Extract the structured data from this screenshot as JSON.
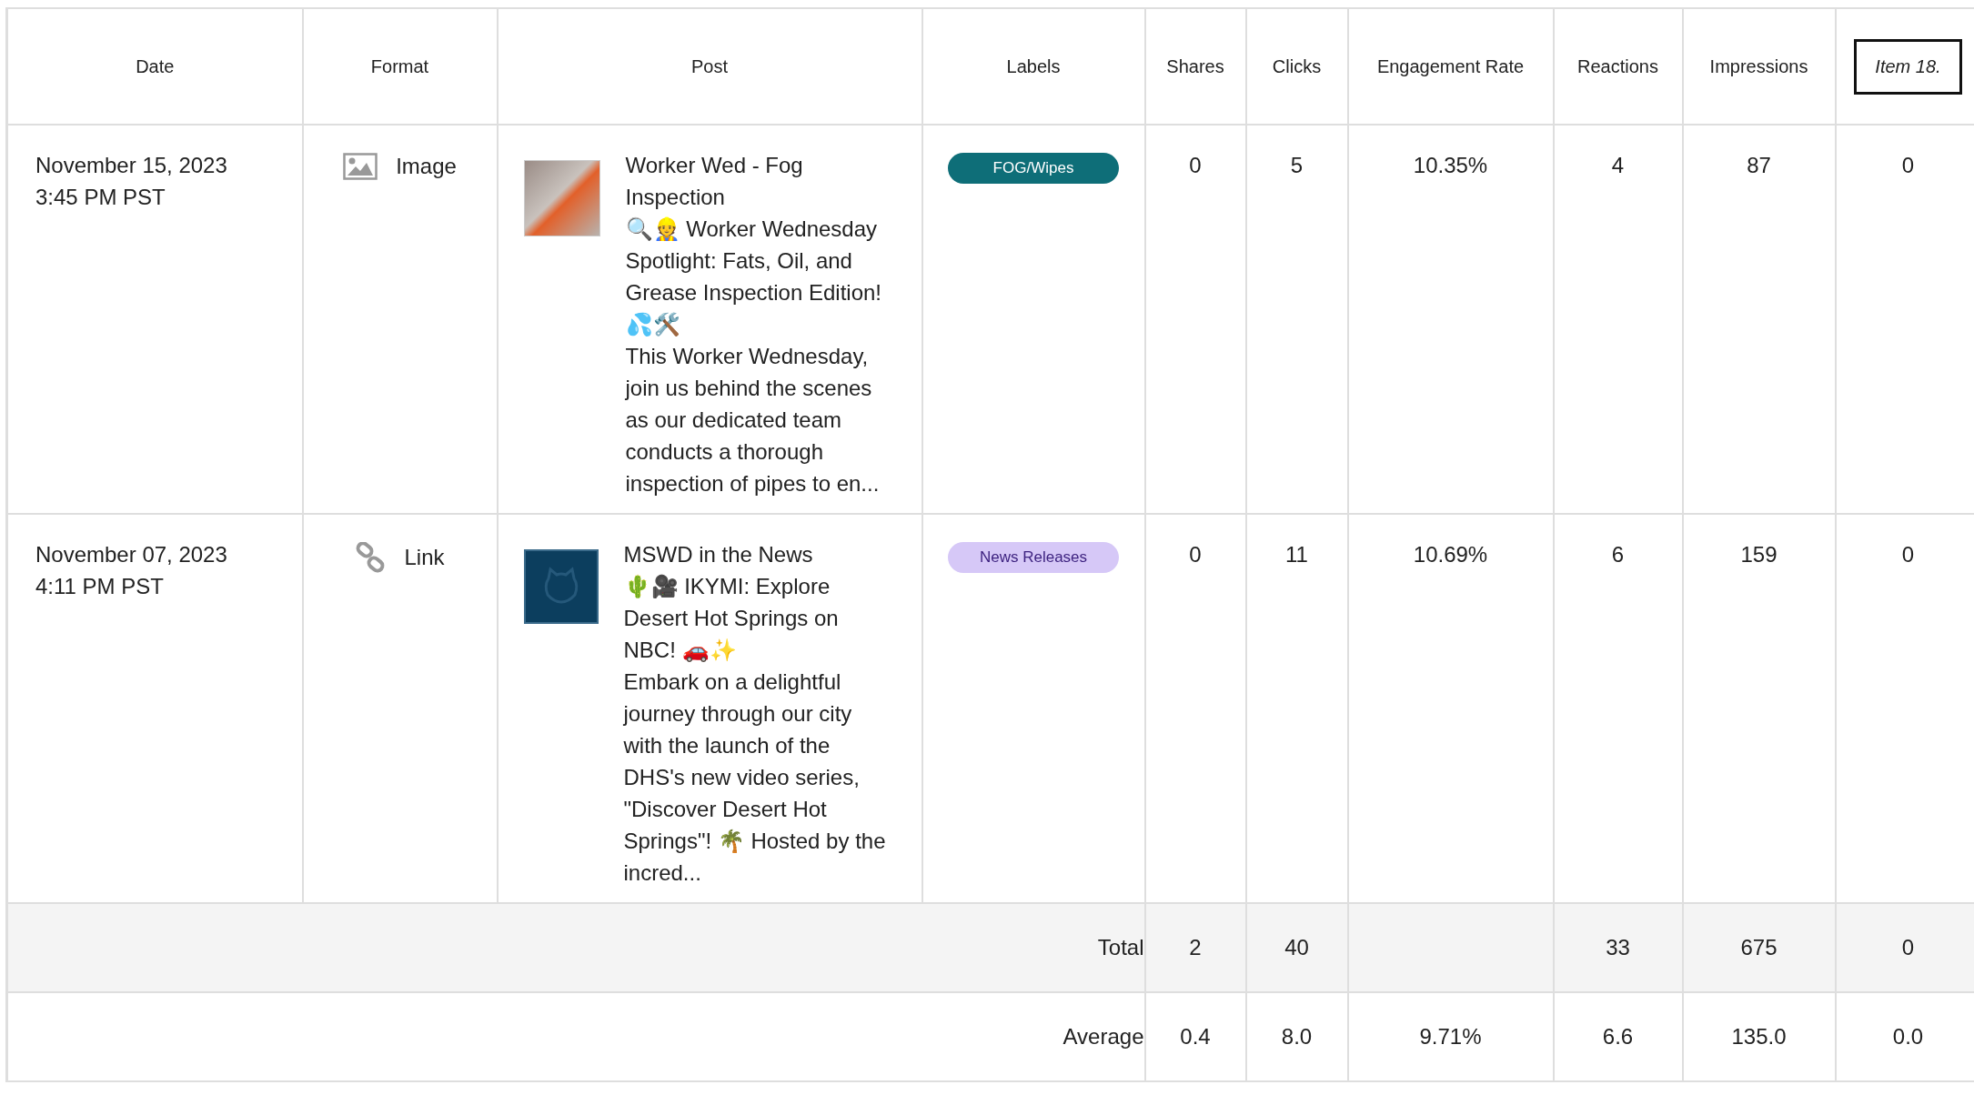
{
  "table": {
    "columns": [
      {
        "label": "Date",
        "focused": false
      },
      {
        "label": "Format",
        "focused": false
      },
      {
        "label": "Post",
        "focused": false
      },
      {
        "label": "Labels",
        "focused": false
      },
      {
        "label": "Shares",
        "focused": false
      },
      {
        "label": "Clicks",
        "focused": false
      },
      {
        "label": "Engagement Rate",
        "focused": false
      },
      {
        "label": "Reactions",
        "focused": false
      },
      {
        "label": "Impressions",
        "focused": false
      },
      {
        "label": "Item 18.",
        "focused": true
      }
    ],
    "rows": [
      {
        "date": "November 15, 2023",
        "time": "3:45 PM PST",
        "format": {
          "kind": "image",
          "label": "Image"
        },
        "thumbnail": {
          "kind": "photo"
        },
        "post": [
          "Worker Wed - Fog Inspection",
          "🔍👷 Worker Wednesday Spotlight: Fats, Oil, and Grease Inspection Edition! 💦🛠️",
          "This Worker Wednesday, join us behind the scenes as our dedicated team conducts a thorough inspection of pipes to en..."
        ],
        "label": {
          "text": "FOG/Wipes",
          "color": "#0e6e78"
        },
        "values": [
          "0",
          "5",
          "10.35%",
          "4",
          "87",
          "0"
        ]
      },
      {
        "date": "November 07, 2023",
        "time": "4:11 PM PST",
        "format": {
          "kind": "link",
          "label": "Link"
        },
        "thumbnail": {
          "kind": "logo"
        },
        "post": [
          "MSWD in the News",
          "🌵🎥 IKYMI: Explore Desert Hot Springs on NBC! 🚗✨",
          "Embark on a delightful journey through our city with the launch of the DHS's new video series, \"Discover Desert Hot Springs\"! 🌴 Hosted by the incred..."
        ],
        "label": {
          "text": "News Releases",
          "color": "#d6c8f7"
        },
        "values": [
          "0",
          "11",
          "10.69%",
          "6",
          "159",
          "0"
        ]
      }
    ],
    "summary": [
      {
        "label": "Total",
        "shares": "2",
        "clicks": "40",
        "reactions": "33",
        "impressions": "675",
        "item_18": "0"
      },
      {
        "label": "Average",
        "shares": "0.4",
        "clicks": "8.0",
        "engagement_rate": "9.71%",
        "reactions": "6.6",
        "impressions": "135.0",
        "item_18": "0.0"
      }
    ]
  }
}
